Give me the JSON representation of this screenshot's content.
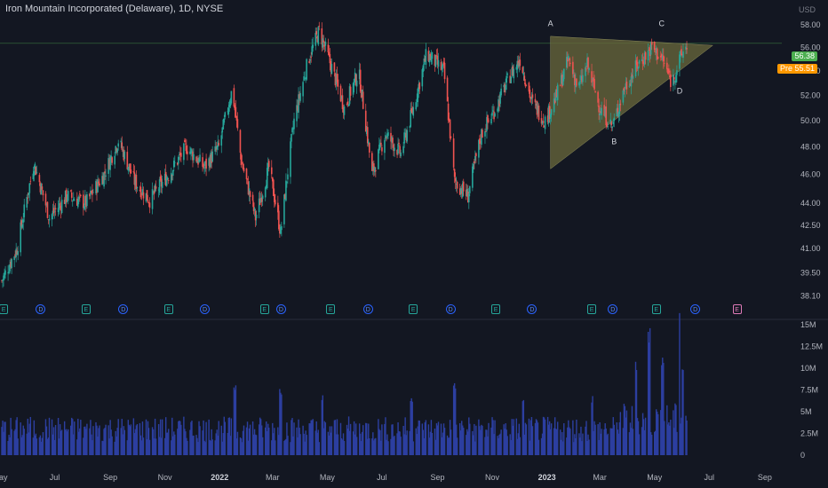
{
  "header": {
    "title": "Iron Mountain Incorporated (Delaware), 1D, NYSE",
    "currency": "USD"
  },
  "price_badges": {
    "last": "56.38",
    "pre_label": "Pre",
    "pre_value": "55.51"
  },
  "colors": {
    "background": "#131722",
    "up": "#26a69a",
    "down": "#ef5350",
    "volume": "#2c3fa0",
    "triangle_fill": "#6b6a3c",
    "last_price": "#4caf50",
    "pre_market": "#ff9800"
  },
  "events": [
    {
      "type": "E",
      "label": "E"
    },
    {
      "type": "D",
      "label": "D"
    },
    {
      "type": "E",
      "label": "E"
    },
    {
      "type": "D",
      "label": "D"
    },
    {
      "type": "E",
      "label": "E"
    },
    {
      "type": "D",
      "label": "D"
    },
    {
      "type": "E",
      "label": "E"
    },
    {
      "type": "D",
      "label": "D"
    },
    {
      "type": "E",
      "label": "E"
    },
    {
      "type": "D",
      "label": "D"
    },
    {
      "type": "E",
      "label": "E"
    },
    {
      "type": "D",
      "label": "D"
    },
    {
      "type": "E",
      "label": "E"
    },
    {
      "type": "D",
      "label": "D"
    },
    {
      "type": "E",
      "label": "E"
    },
    {
      "type": "D",
      "label": "D"
    },
    {
      "type": "E",
      "label": "E"
    },
    {
      "type": "D",
      "label": "D"
    },
    {
      "type": "Eu",
      "label": "E"
    }
  ],
  "chart_data": {
    "type": "candlestick",
    "title": "Iron Mountain Incorporated (Delaware), 1D, NYSE",
    "price_axis": {
      "ticks": [
        "38.10",
        "39.50",
        "41.00",
        "42.50",
        "44.00",
        "46.00",
        "48.00",
        "50.00",
        "52.00",
        "54.00",
        "56.00",
        "58.00"
      ],
      "tick_values": [
        38.1,
        39.5,
        41,
        42.5,
        44,
        46,
        48,
        50,
        52,
        54,
        56,
        58
      ],
      "scale": "log",
      "range": [
        37.5,
        58.5
      ]
    },
    "volume_axis": {
      "ticks": [
        "0",
        "2.5M",
        "5M",
        "7.5M",
        "10M",
        "12.5M",
        "15M"
      ],
      "tick_values": [
        0,
        2.5,
        5,
        7.5,
        10,
        12.5,
        15
      ],
      "unit": "M"
    },
    "time_axis": {
      "labels": [
        "May",
        "Jul",
        "Sep",
        "Nov",
        "2022",
        "Mar",
        "May",
        "Jul",
        "Sep",
        "Nov",
        "2023",
        "Mar",
        "May",
        "Jul",
        "Sep"
      ],
      "bold": [
        "2022",
        "2023"
      ],
      "start": "2021-05-01",
      "end": "2023-09-20"
    },
    "close_anchors": [
      [
        "2021-05-03",
        39.0
      ],
      [
        "2021-05-20",
        41.0
      ],
      [
        "2021-06-08",
        46.8
      ],
      [
        "2021-06-25",
        43.0
      ],
      [
        "2021-07-15",
        44.5
      ],
      [
        "2021-08-05",
        44.0
      ],
      [
        "2021-08-25",
        46.0
      ],
      [
        "2021-09-10",
        48.5
      ],
      [
        "2021-09-28",
        45.5
      ],
      [
        "2021-10-15",
        44.2
      ],
      [
        "2021-11-05",
        46.0
      ],
      [
        "2021-11-25",
        48.0
      ],
      [
        "2021-12-15",
        46.5
      ],
      [
        "2021-12-31",
        48.0
      ],
      [
        "2022-01-15",
        52.5
      ],
      [
        "2022-01-25",
        47.0
      ],
      [
        "2022-02-10",
        43.0
      ],
      [
        "2022-02-25",
        46.5
      ],
      [
        "2022-03-10",
        42.0
      ],
      [
        "2022-03-25",
        50.0
      ],
      [
        "2022-04-10",
        55.0
      ],
      [
        "2022-04-22",
        57.5
      ],
      [
        "2022-05-05",
        54.5
      ],
      [
        "2022-05-20",
        51.0
      ],
      [
        "2022-06-05",
        54.0
      ],
      [
        "2022-06-20",
        46.0
      ],
      [
        "2022-07-05",
        49.0
      ],
      [
        "2022-07-22",
        47.5
      ],
      [
        "2022-08-05",
        51.0
      ],
      [
        "2022-08-20",
        55.5
      ],
      [
        "2022-09-08",
        54.0
      ],
      [
        "2022-09-20",
        45.5
      ],
      [
        "2022-10-05",
        44.5
      ],
      [
        "2022-10-20",
        49.0
      ],
      [
        "2022-11-05",
        51.0
      ],
      [
        "2022-11-20",
        53.5
      ],
      [
        "2022-12-02",
        55.0
      ],
      [
        "2022-12-15",
        51.5
      ],
      [
        "2022-12-30",
        50.0
      ],
      [
        "2023-01-12",
        52.0
      ],
      [
        "2023-01-25",
        55.0
      ],
      [
        "2023-02-05",
        52.5
      ],
      [
        "2023-02-15",
        54.5
      ],
      [
        "2023-03-01",
        51.0
      ],
      [
        "2023-03-15",
        49.5
      ],
      [
        "2023-03-28",
        52.5
      ],
      [
        "2023-04-12",
        54.5
      ],
      [
        "2023-04-28",
        56.0
      ],
      [
        "2023-05-10",
        55.0
      ],
      [
        "2023-05-20",
        53.0
      ],
      [
        "2023-06-01",
        55.5
      ],
      [
        "2023-06-06",
        56.3
      ]
    ],
    "volume_profile": {
      "baseline_millions": 3.3,
      "spikes": [
        [
          "2022-01-18",
          8.5
        ],
        [
          "2022-03-10",
          8.0
        ],
        [
          "2022-04-25",
          7.0
        ],
        [
          "2022-08-03",
          7.0
        ],
        [
          "2022-09-20",
          8.5
        ],
        [
          "2022-12-05",
          6.5
        ],
        [
          "2023-02-20",
          7.0
        ],
        [
          "2023-04-10",
          8.5
        ],
        [
          "2023-04-25",
          11.0
        ],
        [
          "2023-05-10",
          9.0
        ],
        [
          "2023-05-28",
          13.5
        ],
        [
          "2023-06-02",
          8.0
        ]
      ]
    },
    "triangle_pattern": {
      "points": [
        {
          "label": "A",
          "date": "2023-01-05",
          "price": 56.8
        },
        {
          "label": "B",
          "date": "2023-03-17",
          "price": 49.0
        },
        {
          "label": "C",
          "date": "2023-05-09",
          "price": 56.8
        },
        {
          "label": "D",
          "date": "2023-05-29",
          "price": 53.0
        }
      ],
      "apex": {
        "date": "2023-07-05",
        "price": 56.2
      },
      "upper_start": {
        "date": "2023-01-05",
        "price": 57.0
      },
      "lower_start": {
        "date": "2023-01-05",
        "price": 46.4
      }
    },
    "last_price": 56.38,
    "pre_market_price": 55.51,
    "event_dates": [
      "2021-05-05",
      "2021-06-15",
      "2021-08-05",
      "2021-09-15",
      "2021-11-05",
      "2021-12-15",
      "2022-02-20",
      "2022-03-10",
      "2022-05-05",
      "2022-06-15",
      "2022-08-05",
      "2022-09-15",
      "2022-11-05",
      "2022-12-15",
      "2023-02-20",
      "2023-03-15",
      "2023-05-03",
      "2023-06-15",
      "2023-08-01"
    ]
  }
}
